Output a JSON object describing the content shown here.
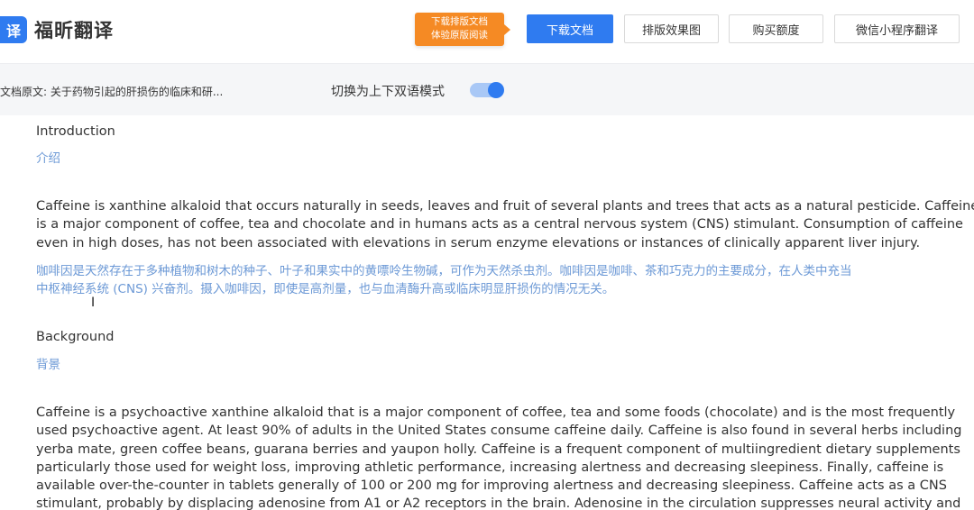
{
  "header": {
    "logo_icon_text": "译",
    "logo_text": "福昕翻译",
    "promo_line1": "下载排版文档",
    "promo_line2": "体验原版阅读",
    "download_label": "下载文档",
    "layout_preview_label": "排版效果图",
    "buy_quota_label": "购买额度",
    "wechat_label": "微信小程序翻译"
  },
  "infobar": {
    "doc_original": "文档原文:  关于药物引起的肝损伤的临床和研...",
    "mode_label": "切换为上下双语模式",
    "mode_on": true
  },
  "sections": [
    {
      "heading_en": "Introduction",
      "heading_zh": "介绍",
      "para_en": [
        "Caffeine is xanthine alkaloid that occurs naturally in seeds, leaves and fruit of several plants and trees that acts as a natural pesticide. Caffeine",
        "is a major component of coffee, tea and chocolate and in humans acts as a central nervous system (CNS) stimulant. Consumption of caffeine",
        "even in high doses, has not been associated with elevations in serum enzyme elevations or instances of clinically apparent liver injury."
      ],
      "para_zh": [
        "咖啡因是天然存在于多种植物和树木的种子、叶子和果实中的黄嘌呤生物碱，可作为天然杀虫剂。咖啡因是咖啡、茶和巧克力的主要成分，在人类中充当",
        "中枢神经系统 (CNS) 兴奋剂。摄入咖啡因，即使是高剂量，也与血清酶升高或临床明显肝损伤的情况无关。"
      ]
    },
    {
      "heading_en": "Background",
      "heading_zh": "背景",
      "para_en": [
        "Caffeine is a psychoactive xanthine alkaloid that is a major component of coffee, tea and some foods (chocolate) and is the most frequently",
        "used psychoactive agent. At least 90% of adults in the United States consume caffeine daily. Caffeine is also found in several herbs including",
        "yerba mate, green coffee beans, guarana berries and yaupon holly. Caffeine is a frequent component of multiingredient dietary supplements",
        "particularly those used for weight loss, improving athletic performance, increasing alertness and decreasing sleepiness. Finally, caffeine is",
        "available over-the-counter in tablets generally of 100 or 200 mg for improving alertness and decreasing sleepiness. Caffeine acts as a CNS",
        "stimulant, probably by displacing adenosine from A1 or A2 receptors in the brain. Adenosine in the circulation suppresses neural activity and"
      ]
    }
  ]
}
